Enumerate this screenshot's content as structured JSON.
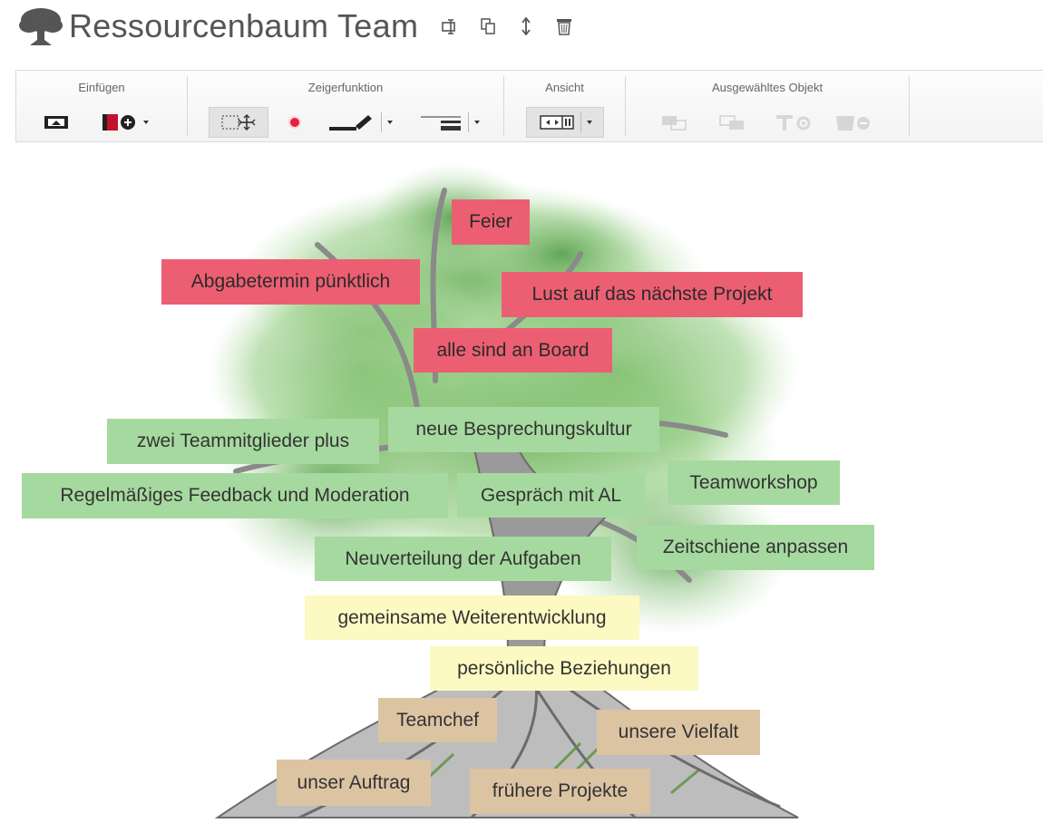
{
  "header": {
    "title": "Ressourcenbaum Team",
    "actions": [
      {
        "icon": "edit-text-icon"
      },
      {
        "icon": "copy-icon"
      },
      {
        "icon": "move-vertical-icon"
      },
      {
        "icon": "trash-icon"
      }
    ]
  },
  "toolbar": {
    "groups": {
      "insert": "Einfügen",
      "pointer": "Zeigerfunktion",
      "view": "Ansicht",
      "selected": "Ausgewähltes Objekt"
    }
  },
  "notes": [
    {
      "text": "Feier",
      "color": "red"
    },
    {
      "text": "Abgabetermin pünktlich",
      "color": "red"
    },
    {
      "text": "Lust auf das nächste Projekt",
      "color": "red"
    },
    {
      "text": "alle sind an Board",
      "color": "red"
    },
    {
      "text": "zwei Teammitglieder plus",
      "color": "green"
    },
    {
      "text": "neue Besprechungskultur",
      "color": "green"
    },
    {
      "text": "Teamworkshop",
      "color": "green"
    },
    {
      "text": "Regelmäßiges Feedback und Moderation",
      "color": "green"
    },
    {
      "text": "Gespräch mit AL",
      "color": "green"
    },
    {
      "text": "Neuverteilung der Aufgaben",
      "color": "green"
    },
    {
      "text": "Zeitschiene anpassen",
      "color": "green"
    },
    {
      "text": "gemeinsame Weiterentwicklung",
      "color": "yellow"
    },
    {
      "text": "persönliche Beziehungen",
      "color": "yellow"
    },
    {
      "text": "Teamchef",
      "color": "tan"
    },
    {
      "text": "unsere Vielfalt",
      "color": "tan"
    },
    {
      "text": "unser Auftrag",
      "color": "tan"
    },
    {
      "text": "frühere Projekte",
      "color": "tan"
    }
  ],
  "colors": {
    "red": "#ec5f73",
    "green": "#a6d99f",
    "yellow": "#fcf9c2",
    "tan": "#dcc4a3"
  }
}
